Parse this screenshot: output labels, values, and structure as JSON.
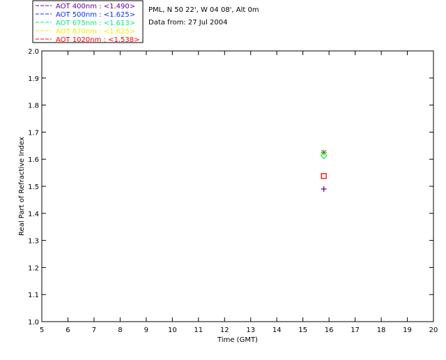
{
  "chart_data": {
    "type": "scatter",
    "xlabel": "Time (GMT)",
    "ylabel": "Real Part of Refractive Index",
    "xlim": [
      5,
      20
    ],
    "ylim": [
      1.0,
      2.0
    ],
    "xticks": [
      "5",
      "6",
      "7",
      "8",
      "9",
      "10",
      "11",
      "12",
      "13",
      "14",
      "15",
      "16",
      "17",
      "18",
      "19",
      "20"
    ],
    "yticks": [
      "1.0",
      "1.1",
      "1.2",
      "1.3",
      "1.4",
      "1.5",
      "1.6",
      "1.7",
      "1.8",
      "1.9",
      "2.0"
    ],
    "grid": false,
    "legend_position": "top-left",
    "info": [
      "PML, N 50 22', W 04 08', Alt 0m",
      "Data from: 27 Jul 2004"
    ],
    "series": [
      {
        "name": "AOT  400nm : <1.490>",
        "color": "#6600aa",
        "marker": "plus",
        "x": [
          15.8
        ],
        "y": [
          1.49
        ]
      },
      {
        "name": "AOT  500nm : <1.625>",
        "color": "#0033ff",
        "marker": "asterisk",
        "x": [
          15.8
        ],
        "y": [
          1.625
        ]
      },
      {
        "name": "AOT  675nm : <1.613>",
        "color": "#00ee77",
        "marker": "diamond",
        "x": [
          15.8
        ],
        "y": [
          1.613
        ]
      },
      {
        "name": "AOT  870nm : <1.625>",
        "color": "#eeee00",
        "marker": "triangle",
        "x": [
          15.8
        ],
        "y": [
          1.625
        ]
      },
      {
        "name": "AOT 1020nm : <1.538>",
        "color": "#ff0000",
        "marker": "square",
        "x": [
          15.8
        ],
        "y": [
          1.538
        ]
      }
    ]
  }
}
